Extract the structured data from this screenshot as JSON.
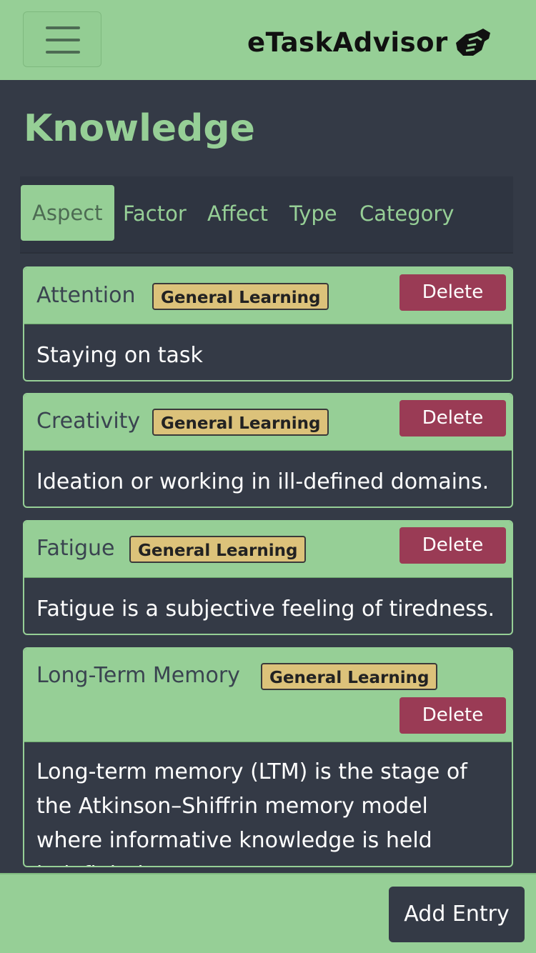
{
  "app": {
    "title": "eTaskAdvisor",
    "logo_icon": "handshake-icon"
  },
  "page": {
    "title": "Knowledge"
  },
  "tabs": [
    {
      "label": "Aspect",
      "active": true
    },
    {
      "label": "Factor",
      "active": false
    },
    {
      "label": "Affect",
      "active": false
    },
    {
      "label": "Type",
      "active": false
    },
    {
      "label": "Category",
      "active": false
    }
  ],
  "entries": [
    {
      "title": "Attention",
      "badge": "General Learning",
      "delete_label": "Delete",
      "description": "Staying on task"
    },
    {
      "title": "Creativity",
      "badge": "General Learning",
      "delete_label": "Delete",
      "description": "Ideation or working in ill-defined domains."
    },
    {
      "title": "Fatigue",
      "badge": "General Learning",
      "delete_label": "Delete",
      "description": "Fatigue is a subjective feeling of tiredness."
    },
    {
      "title": "Long-Term Memory",
      "badge": "General Learning",
      "delete_label": "Delete",
      "description": "Long-term memory (LTM) is the stage of the Atkinson–Shiffrin memory model where informative knowledge is held indefinitely."
    }
  ],
  "footer": {
    "add_label": "Add Entry"
  },
  "colors": {
    "accent": "#96cf96",
    "background": "#343a46",
    "danger": "#9a3b55",
    "badge": "#dcc27a"
  }
}
